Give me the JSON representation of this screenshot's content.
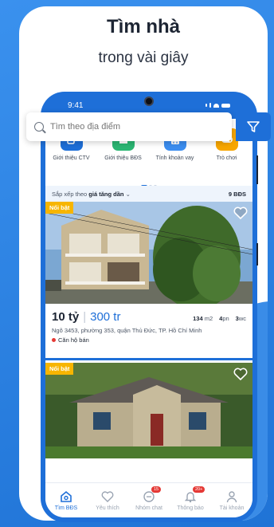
{
  "headline": {
    "title": "Tìm nhà",
    "subtitle": "trong vài giây"
  },
  "status_bar": {
    "time": "9:41"
  },
  "search": {
    "placeholder": "Tìm theo địa điểm"
  },
  "quick_actions": [
    {
      "label": "Giới thiệu CTV",
      "icon": "share-icon",
      "color": "#1e6fd8"
    },
    {
      "label": "Giới thiệu BĐS",
      "icon": "house-plus-icon",
      "color": "#2bb673"
    },
    {
      "label": "Tính khoản vay",
      "icon": "calculator-icon",
      "color": "#3b8df0"
    },
    {
      "label": "Trò chơi",
      "icon": "gamepad-icon",
      "color": "#f7a600"
    }
  ],
  "sort": {
    "prefix": "Sắp xếp theo",
    "value": "giá tăng dần",
    "count": "9 BĐS"
  },
  "listings": [
    {
      "badge": "Nổi bật",
      "price_total": "10 tỷ",
      "price_per": "300 tr",
      "area": "134",
      "area_unit": "m2",
      "bedrooms": "4",
      "bedrooms_unit": "pn",
      "bathrooms": "3",
      "bathrooms_unit": "wc",
      "address": "Ngõ 3453, phường 353, quận Thủ Đức, TP. Hồ Chí Minh",
      "type": "Căn hộ bán"
    },
    {
      "badge": "Nổi bật"
    }
  ],
  "tabs": [
    {
      "label": "Tìm BĐS",
      "active": true
    },
    {
      "label": "Yêu thích"
    },
    {
      "label": "Nhóm chat",
      "badge": "15"
    },
    {
      "label": "Thông báo",
      "badge": "20+"
    },
    {
      "label": "Tài khoản"
    }
  ]
}
